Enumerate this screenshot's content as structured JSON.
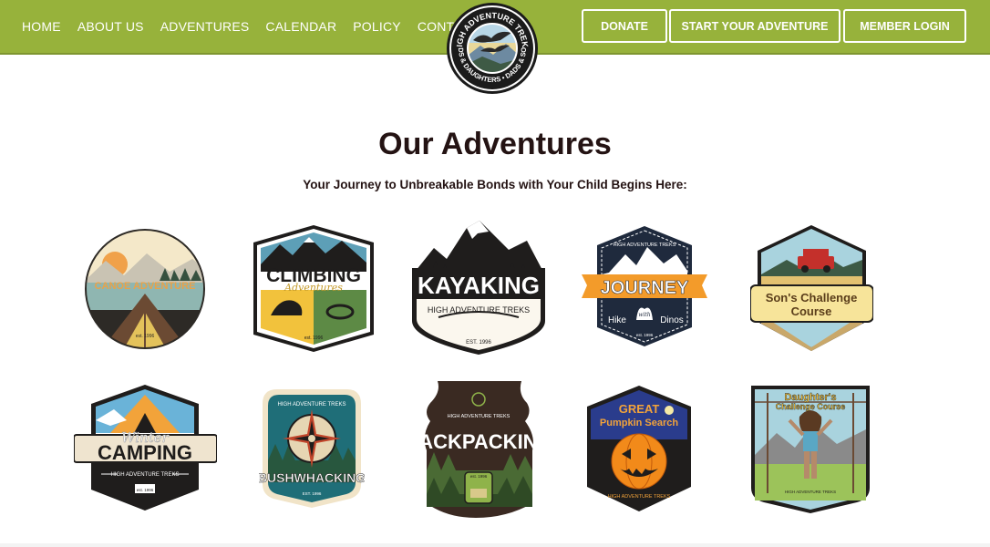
{
  "nav": {
    "items": [
      "HOME",
      "ABOUT US",
      "ADVENTURES",
      "CALENDAR",
      "POLICY",
      "CONTACT"
    ]
  },
  "header_buttons": {
    "donate": "DONATE",
    "start": "START YOUR ADVENTURE",
    "login": "MEMBER LOGIN"
  },
  "logo": {
    "top_text": "HIGH ADVENTURE TREKS",
    "bottom_text": "DADS & DAUGHTERS • DADS & SONS"
  },
  "page": {
    "title": "Our Adventures",
    "subtitle": "Your Journey to Unbreakable Bonds with Your Child Begins Here:"
  },
  "badges": {
    "canoe": {
      "name": "CANOE ADVENTURE",
      "est": "est. 1996"
    },
    "climbing": {
      "name": "CLIMBING",
      "script": "Adventures",
      "est": "est. 1996"
    },
    "kayaking": {
      "name": "KAYAKING",
      "org": "HIGH ADVENTURE TREKS",
      "est": "EST. 1996"
    },
    "journey": {
      "org": "HIGH ADVENTURE TREKS",
      "name": "JOURNEY",
      "hike": "Hike",
      "with": "with",
      "dinos": "Dinos",
      "est": "est. 1996"
    },
    "sons": {
      "line1": "Son's Challenge",
      "line2": "Course"
    },
    "camping": {
      "script": "Winter",
      "name": "CAMPING",
      "org": "HIGH ADVENTURE TREKS",
      "est": "est. 1996"
    },
    "bushwhacking": {
      "org": "HIGH ADVENTURE TREKS",
      "name": "BUSHWHACKING",
      "est": "EST. 1996"
    },
    "backpacking": {
      "org": "HIGH ADVENTURE TREKS",
      "name": "BACKPACKING",
      "est": "est. 1996"
    },
    "pumpkin": {
      "line1": "GREAT",
      "line2": "Pumpkin Search",
      "org": "HIGH ADVENTURE TREKS"
    },
    "daughters": {
      "line1": "Daughter's",
      "line2": "Challenge Course",
      "org": "HIGH ADVENTURE TREKS"
    }
  }
}
